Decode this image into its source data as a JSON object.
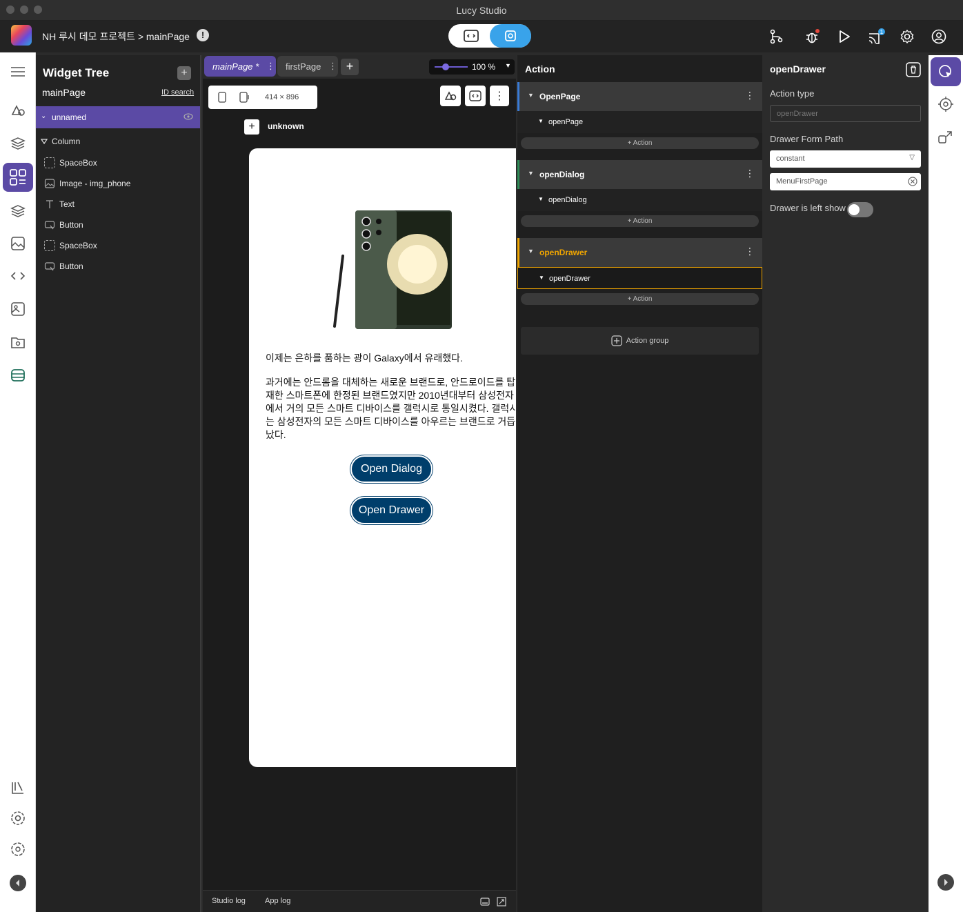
{
  "window": {
    "title": "Lucy Studio"
  },
  "topbar": {
    "project": "NH 루시 데모 프로젝트 > mainPage",
    "warning": "!",
    "notification_count": "1"
  },
  "widget_tree": {
    "title": "Widget Tree",
    "page": "mainPage",
    "id_search": "ID search",
    "selected": "unnamed",
    "items": [
      {
        "label": "Column",
        "icon": "column-icon"
      },
      {
        "label": "SpaceBox",
        "icon": "spacebox-icon"
      },
      {
        "label": "Image - img_phone",
        "icon": "image-icon"
      },
      {
        "label": "Text",
        "icon": "text-icon"
      },
      {
        "label": "Button",
        "icon": "button-icon"
      },
      {
        "label": "SpaceBox",
        "icon": "spacebox-icon"
      },
      {
        "label": "Button",
        "icon": "button-icon"
      }
    ]
  },
  "canvas": {
    "tabs": [
      {
        "label": "mainPage *"
      },
      {
        "label": "firstPage"
      }
    ],
    "add_tab": "+",
    "zoom": "100 %",
    "device_size": "414 × 896",
    "unknown_label": "unknown",
    "phone": {
      "title": "이제는 은하를 품하는 광이 Galaxy에서 유래했다.",
      "body": "과거에는 안드롬을 대체하는 새로운 브랜드로, 안드로이드를 탑재한 스마트폰에 한정된 브랜드였지만 2010년대부터 삼성전자에서 거의 모든 스마트 디바이스를 갤럭시로 통일시켰다. 갤럭시는 삼성전자의 모든 스마트 디바이스를 아우르는 브랜드로 거듭났다.",
      "button1": "Open Dialog",
      "button2": "Open Drawer"
    },
    "log_tabs": {
      "studio": "Studio log",
      "app": "App log"
    }
  },
  "action_panel": {
    "title": "Action",
    "groups": [
      {
        "name": "OpenPage",
        "item": "openPage",
        "color": "#3a7bd5",
        "add": "+ Action"
      },
      {
        "name": "openDialog",
        "item": "openDialog",
        "color": "#2e8b57",
        "add": "+ Action"
      },
      {
        "name": "openDrawer",
        "item": "openDrawer",
        "color": "#f0a500",
        "add": "+ Action"
      }
    ],
    "action_group": "Action group"
  },
  "properties": {
    "title": "openDrawer",
    "action_type_label": "Action type",
    "action_type_placeholder": "openDrawer",
    "drawer_path_label": "Drawer Form Path",
    "drawer_path_mode": "constant",
    "drawer_path_value": "MenuFirstPage",
    "left_show_label": "Drawer is left show",
    "left_show_on": false
  },
  "colors": {
    "accent": "#5b4aa5",
    "primary_button": "#003e6b",
    "highlight": "#f0a500",
    "blue_toggle": "#39a3ea"
  }
}
